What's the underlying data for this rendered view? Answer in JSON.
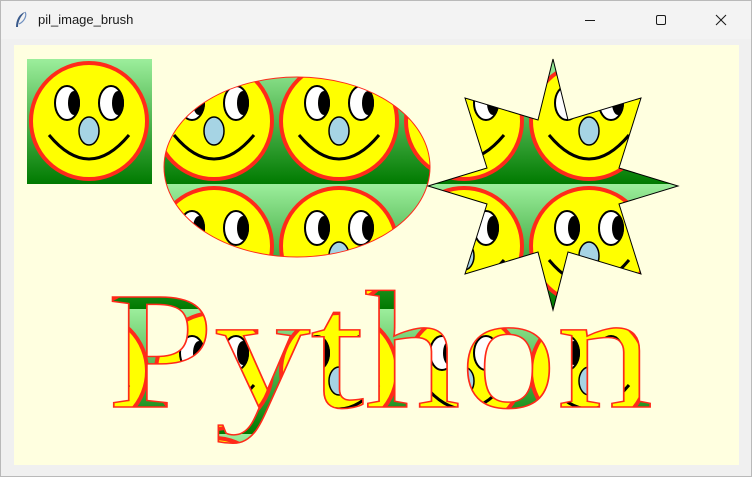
{
  "window": {
    "title": "pil_image_brush",
    "app_icon": "feather-icon",
    "controls": [
      "minimize-icon",
      "maximize-icon",
      "close-icon"
    ]
  },
  "canvas": {
    "background": "#ffffe0",
    "shapes": [
      "rectangle",
      "ellipse",
      "star"
    ],
    "text": "Python",
    "brush": "smiley-face-image",
    "colors": {
      "gradient_top": "#9cee9c",
      "gradient_bottom": "#007a00",
      "face": "#ffff00",
      "face_outline": "#ff2a1a",
      "nose": "#a6d4e4",
      "outline": "#ff2a1a"
    }
  }
}
